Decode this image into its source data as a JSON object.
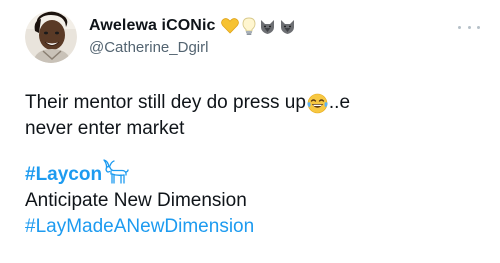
{
  "author": {
    "display_name": "Awelewa iCONic",
    "handle": "@Catherine_Dgirl",
    "badges": [
      "yellow-heart-icon",
      "light-bulb-icon",
      "wolf-icon",
      "wolf-icon"
    ]
  },
  "tweet": {
    "text_line1": "Their mentor still dey do press up",
    "text_line1_emoji": "tears-of-joy-emoji-icon",
    "text_line1_tail": "..e",
    "text_line2": "never enter market",
    "hashtag_laycon": "#Laycon",
    "hashtag_laycon_emoji": "goat-emoji-icon",
    "text_line4": "Anticipate New Dimension",
    "hashtag_newdim": "#LayMadeANewDimension"
  },
  "colors": {
    "text": "#0f1419",
    "secondary": "#536471",
    "link": "#1d9bf0"
  }
}
